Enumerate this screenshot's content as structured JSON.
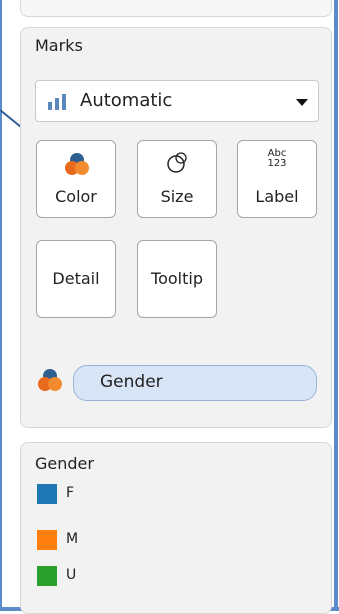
{
  "marks": {
    "title": "Marks",
    "mark_type": "Automatic",
    "buttons": [
      {
        "label": "Color",
        "icon": "color-icon"
      },
      {
        "label": "Size",
        "icon": "size-icon"
      },
      {
        "label": "Label",
        "icon": "label-icon",
        "icon_text_top": "Abc",
        "icon_text_bottom": "123"
      },
      {
        "label": "Detail"
      },
      {
        "label": "Tooltip"
      }
    ],
    "field_pill": {
      "label": "Gender",
      "icon": "color-icon"
    }
  },
  "legend": {
    "title": "Gender",
    "items": [
      {
        "label": "F",
        "color": "#1f77b4"
      },
      {
        "label": "M",
        "color": "#ff7f0e"
      },
      {
        "label": "U",
        "color": "#2ca02c"
      }
    ]
  },
  "colors": {
    "frame": "#5b8cc9",
    "pointer": "#2f5f96",
    "pill_background": "#d8e5f6",
    "bar_icon": "#5b89bf"
  }
}
